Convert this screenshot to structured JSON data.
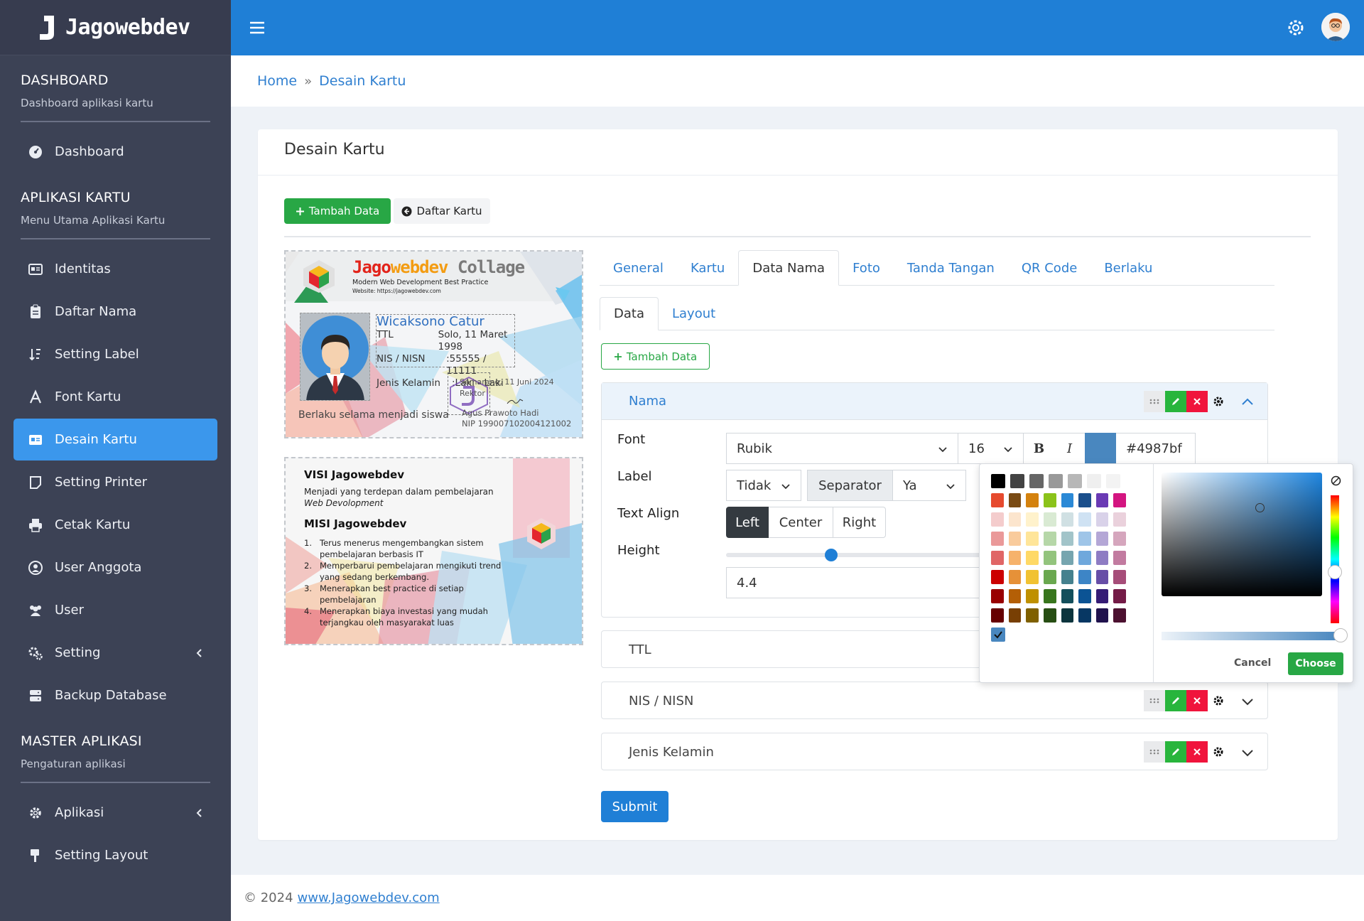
{
  "brand": {
    "name": "Jagowebdev"
  },
  "sidebar": {
    "sections": [
      {
        "title": "DASHBOARD",
        "subtitle": "Dashboard aplikasi kartu"
      },
      {
        "title": "APLIKASI KARTU",
        "subtitle": "Menu Utama Aplikasi Kartu"
      },
      {
        "title": "MASTER APLIKASI",
        "subtitle": "Pengaturan aplikasi"
      }
    ],
    "items": [
      {
        "label": "Dashboard",
        "icon": "gauge-icon"
      },
      {
        "label": "Identitas",
        "icon": "id-card-icon"
      },
      {
        "label": "Daftar Nama",
        "icon": "clipboard-icon"
      },
      {
        "label": "Setting Label",
        "icon": "sort-icon"
      },
      {
        "label": "Font Kartu",
        "icon": "font-icon"
      },
      {
        "label": "Desain Kartu",
        "icon": "id-card-icon",
        "active": true
      },
      {
        "label": "Setting Printer",
        "icon": "note-icon"
      },
      {
        "label": "Cetak Kartu",
        "icon": "printer-icon"
      },
      {
        "label": "User Anggota",
        "icon": "user-circle-icon"
      },
      {
        "label": "User",
        "icon": "users-icon"
      },
      {
        "label": "Setting",
        "icon": "cogs-icon"
      },
      {
        "label": "Backup Database",
        "icon": "database-icon"
      },
      {
        "label": "Aplikasi",
        "icon": "gear-icon"
      },
      {
        "label": "Setting Layout",
        "icon": "brush-icon"
      }
    ]
  },
  "breadcrumb": {
    "home": "Home",
    "separator": "»",
    "current": "Desain Kartu"
  },
  "page": {
    "title": "Desain Kartu",
    "btn_add": "Tambah Data",
    "btn_list": "Daftar Kartu",
    "tabs": [
      "General",
      "Kartu",
      "Data Nama",
      "Foto",
      "Tanda Tangan",
      "QR Code",
      "Berlaku"
    ],
    "active_tab": "Data Nama",
    "subtabs": [
      "Data",
      "Layout"
    ],
    "btn_add_field": "Tambah Data",
    "submit": "Submit"
  },
  "card_front": {
    "brand_a": "Jago",
    "brand_b": "webdev",
    "brand_c": "Collage",
    "tagline": "Modern Web Development Best Practice",
    "website": "Website: https://jagowebdev.com",
    "name": "Wicaksono Catur",
    "rows": [
      {
        "label": "TTL",
        "value": "Solo, 11 Maret 1998"
      },
      {
        "label": "NIS / NISN",
        "value": ":55555 / 11111"
      },
      {
        "label": "Jenis Kelamin",
        "value": ":Laki - Laki"
      }
    ],
    "sign_place": "Semarang, 11 Juni 2024",
    "sign_role": "Rektor",
    "sign_name": "Agus Prawoto Hadi",
    "sign_nip": "NIP 199007102004121002",
    "validity": "Berlaku selama menjadi siswa"
  },
  "card_back": {
    "visi_title": "VISI Jagowebdev",
    "visi_text": "Menjadi yang terdepan dalam pembelajaran",
    "visi_text2": "Web Devolopment",
    "misi_title": "MISI Jagowebdev",
    "misi": [
      {
        "n": "1.",
        "lines": [
          "Terus menerus mengembangkan sistem",
          "pembelajaran berbasis IT"
        ]
      },
      {
        "n": "2.",
        "lines": [
          "Memperbarui pembelajaran mengikuti trend",
          "yang sedang berkembang."
        ]
      },
      {
        "n": "3.",
        "lines": [
          "Menerapkan best practice di setiap",
          "pembelajaran"
        ]
      },
      {
        "n": "4.",
        "lines": [
          "Menerapkan biaya investasi yang mudah",
          "terjangkau oleh masyarakat luas"
        ]
      }
    ]
  },
  "fields": [
    {
      "label": "Nama",
      "expanded": true
    },
    {
      "label": "TTL"
    },
    {
      "label": "NIS / NISN"
    },
    {
      "label": "Jenis Kelamin"
    }
  ],
  "form": {
    "font_label": "Font",
    "font_value": "Rubik",
    "size_value": "16",
    "bold": "B",
    "italic": "I",
    "color_value": "#4987bf",
    "label_label": "Label",
    "label_value": "Tidak",
    "separator_label": "Separator",
    "separator_value": "Ya",
    "align_label": "Text Align",
    "align_options": [
      "Left",
      "Center",
      "Right"
    ],
    "align_active": "Left",
    "height_label": "Height",
    "height_value": "4.4",
    "height_slider_fraction": 0.41
  },
  "picker": {
    "cancel": "Cancel",
    "choose": "Choose",
    "swatches": [
      [
        "#000000",
        "#434343",
        "#666666",
        "#999999",
        "#b7b7b7",
        "#efefef",
        "#f3f3f3"
      ],
      [
        "#e64a2e",
        "#7a4b14",
        "#d4820e",
        "#8bc31a",
        "#2b89d6",
        "#1b4f8c",
        "#6a3ab4",
        "#d31580"
      ],
      [
        "#f4cccc",
        "#fce5cd",
        "#fff2cc",
        "#d9ead3",
        "#d0e0e3",
        "#cfe2f3",
        "#d9d2e9",
        "#ead1dc"
      ],
      [
        "#ea9999",
        "#f9cb9c",
        "#ffe599",
        "#b6d7a8",
        "#a2c4c9",
        "#9fc5e8",
        "#b4a7d6",
        "#d5a6bd"
      ],
      [
        "#e06666",
        "#f6b26b",
        "#ffd966",
        "#93c47d",
        "#76a5af",
        "#6fa8dc",
        "#8e7cc3",
        "#c27ba0"
      ],
      [
        "#cc0000",
        "#e69138",
        "#f1c232",
        "#6aa84f",
        "#45818e",
        "#3d85c6",
        "#674ea7",
        "#a64d79"
      ],
      [
        "#990000",
        "#b45f06",
        "#bf9000",
        "#38761d",
        "#134f5c",
        "#0b5394",
        "#351c75",
        "#741b47"
      ],
      [
        "#660000",
        "#783f04",
        "#7f6000",
        "#274e13",
        "#0c343d",
        "#073763",
        "#20124d",
        "#4c1130"
      ]
    ],
    "selected": "#4987bf"
  },
  "footer": {
    "copy": "© 2024",
    "link": "www.Jagowebdev.com"
  }
}
